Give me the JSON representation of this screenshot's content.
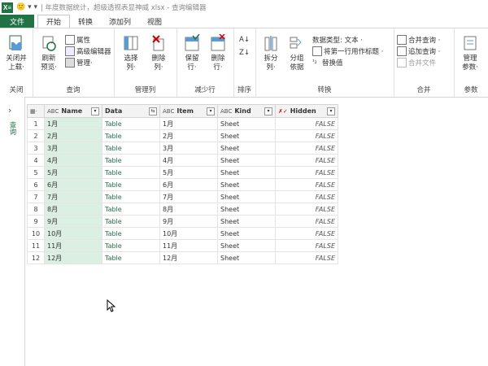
{
  "titlebar": {
    "logo": "X≡",
    "title": "| 年度数据统计，超级透视表显神威 xlsx - 查询编辑器"
  },
  "tabs": [
    {
      "label": "文件"
    },
    {
      "label": "开始"
    },
    {
      "label": "转换"
    },
    {
      "label": "添加列"
    },
    {
      "label": "视图"
    }
  ],
  "ribbon": {
    "groups": {
      "close": "关闭",
      "query": "查询",
      "manage_cols": "管理列",
      "reduce_rows": "减少行",
      "sort": "排序",
      "transform": "转换",
      "combine": "合并",
      "params": "参数"
    },
    "close_load": "关闭并\n上载·",
    "refresh_preview": "刷新\n预览·",
    "properties": "属性",
    "advanced_editor": "高级编辑器",
    "manage": "管理·",
    "choose_cols": "选择\n列·",
    "remove_cols": "删除\n列·",
    "keep_rows": "保留\n行·",
    "remove_rows": "删除\n行·",
    "split_col": "拆分\n列·",
    "group_by": "分组\n依据",
    "data_type": "数据类型: 文本 ·",
    "first_row_header": "将第一行用作标题 ·",
    "replace_values": "替换值",
    "merge_queries": "合并查询 ·",
    "append_queries": "追加查询 ·",
    "merge_files": "合并文件",
    "manage_params": "管理\n参数·"
  },
  "leftpane": {
    "label": "查询"
  },
  "table": {
    "headers": [
      {
        "type": "ABC",
        "name": "Name"
      },
      {
        "type": "",
        "name": "Data"
      },
      {
        "type": "ABC",
        "name": "Item"
      },
      {
        "type": "ABC",
        "name": "Kind"
      },
      {
        "type": "✗✓",
        "name": "Hidden"
      }
    ],
    "rows": [
      [
        "1",
        "1月",
        "Table",
        "1月",
        "Sheet",
        "FALSE"
      ],
      [
        "2",
        "2月",
        "Table",
        "2月",
        "Sheet",
        "FALSE"
      ],
      [
        "3",
        "3月",
        "Table",
        "3月",
        "Sheet",
        "FALSE"
      ],
      [
        "4",
        "4月",
        "Table",
        "4月",
        "Sheet",
        "FALSE"
      ],
      [
        "5",
        "5月",
        "Table",
        "5月",
        "Sheet",
        "FALSE"
      ],
      [
        "6",
        "6月",
        "Table",
        "6月",
        "Sheet",
        "FALSE"
      ],
      [
        "7",
        "7月",
        "Table",
        "7月",
        "Sheet",
        "FALSE"
      ],
      [
        "8",
        "8月",
        "Table",
        "8月",
        "Sheet",
        "FALSE"
      ],
      [
        "9",
        "9月",
        "Table",
        "9月",
        "Sheet",
        "FALSE"
      ],
      [
        "10",
        "10月",
        "Table",
        "10月",
        "Sheet",
        "FALSE"
      ],
      [
        "11",
        "11月",
        "Table",
        "11月",
        "Sheet",
        "FALSE"
      ],
      [
        "12",
        "12月",
        "Table",
        "12月",
        "Sheet",
        "FALSE"
      ]
    ]
  },
  "colors": {
    "accent": "#217346",
    "selection": "#dcefe3"
  }
}
